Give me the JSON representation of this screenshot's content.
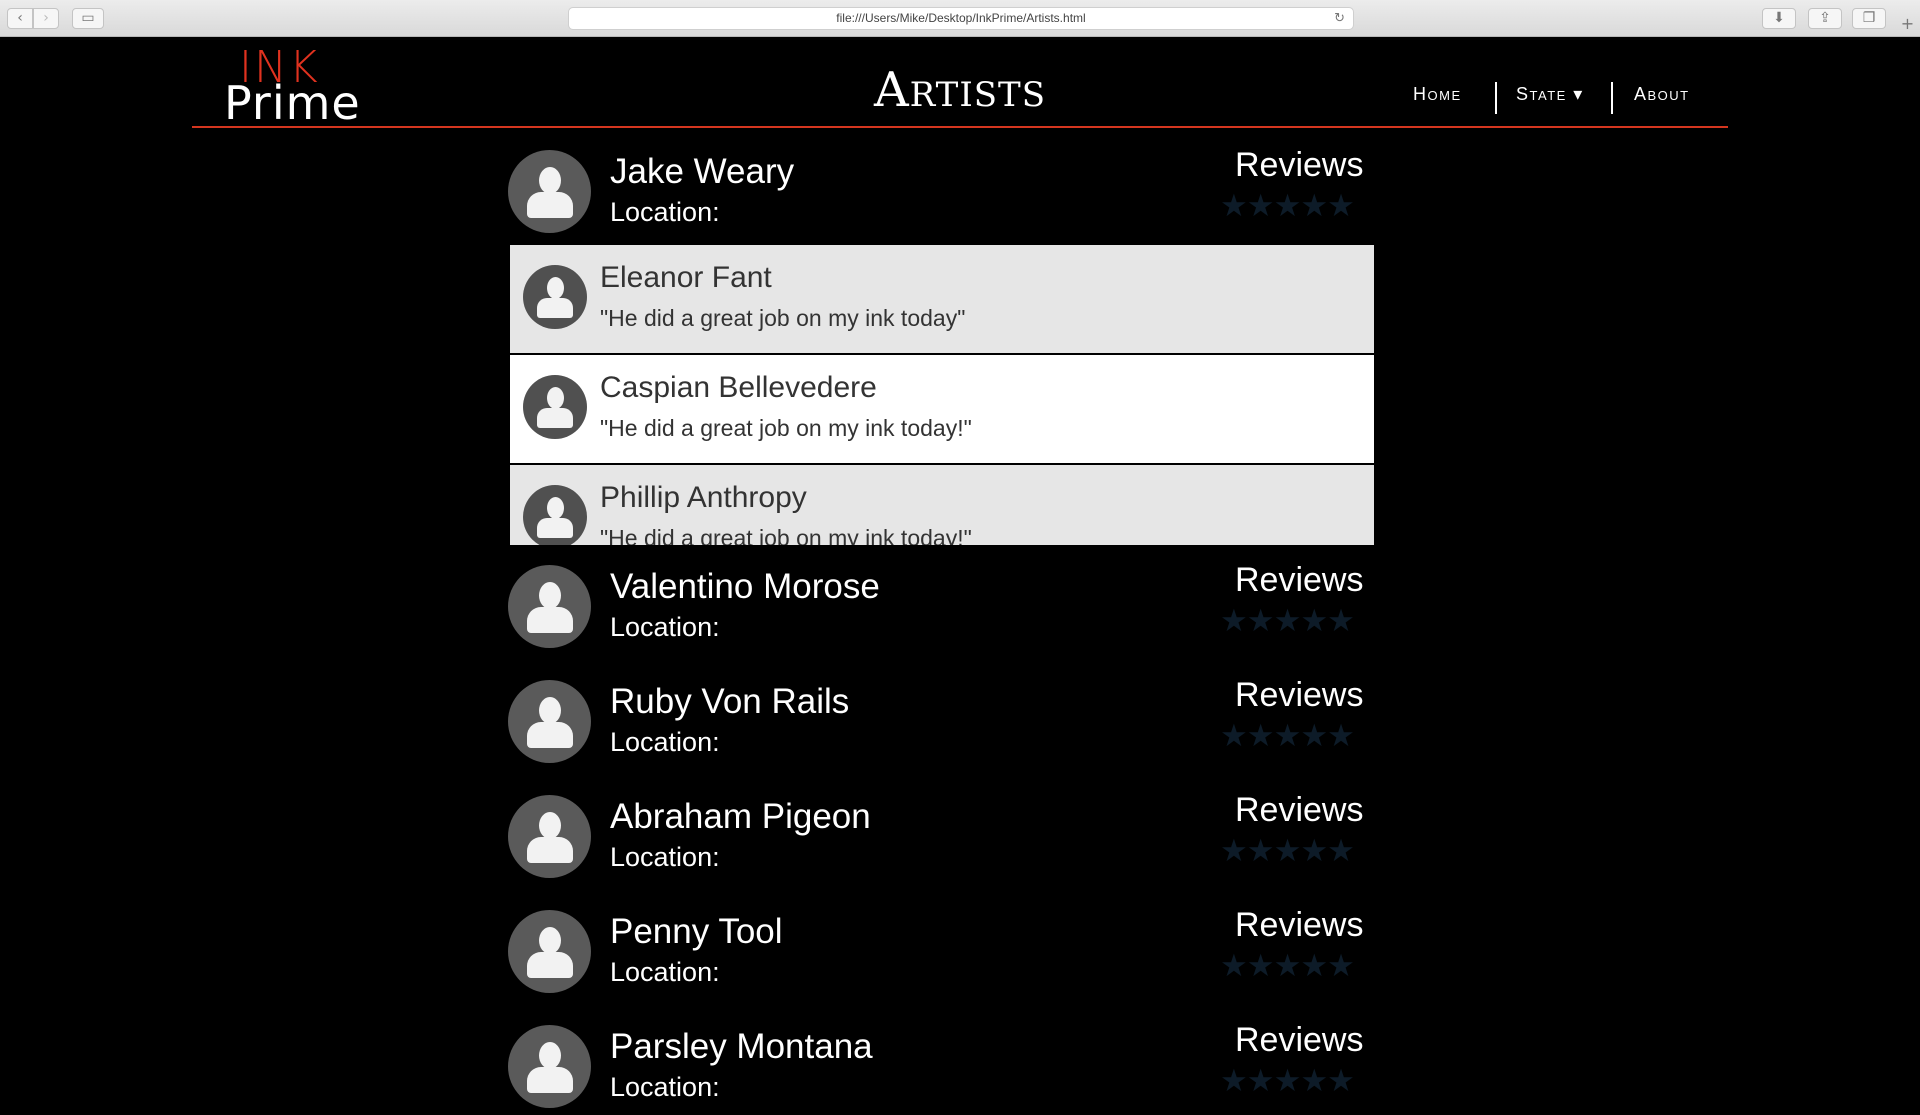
{
  "browser": {
    "address": "file:///Users/Mike/Desktop/InkPrime/Artists.html",
    "back_icon": "chevron-left-icon",
    "forward_icon": "chevron-right-icon",
    "sidebar_icon": "sidebar-icon",
    "reload_icon": "reload-icon",
    "download_icon": "download-icon",
    "share_icon": "share-icon",
    "tabs_icon": "tabs-icon",
    "newtab_icon": "plus-icon"
  },
  "header": {
    "logo_top": "INK",
    "logo_bottom": "Prime",
    "title": "Artists",
    "nav": {
      "home": "Home",
      "state": "State ▾",
      "about": "About"
    },
    "accent_color": "#d4361f"
  },
  "artists": [
    {
      "name": "Jake Weary",
      "location_label": "Location:",
      "reviews_label": "Reviews",
      "rating_stars": 0
    },
    {
      "name": "Valentino Morose",
      "location_label": "Location:",
      "reviews_label": "Reviews",
      "rating_stars": 0
    },
    {
      "name": "Ruby Von Rails",
      "location_label": "Location:",
      "reviews_label": "Reviews",
      "rating_stars": 0
    },
    {
      "name": "Abraham Pigeon",
      "location_label": "Location:",
      "reviews_label": "Reviews",
      "rating_stars": 0
    },
    {
      "name": "Penny Tool",
      "location_label": "Location:",
      "reviews_label": "Reviews",
      "rating_stars": 0
    },
    {
      "name": "Parsley Montana",
      "location_label": "Location:",
      "reviews_label": "Reviews",
      "rating_stars": 0
    }
  ],
  "reviews": [
    {
      "name": "Eleanor Fant",
      "text": "\"He did a great job on my ink today\""
    },
    {
      "name": "Caspian Bellevedere",
      "text": "\"He did a great job on my ink today!\""
    },
    {
      "name": "Phillip Anthropy",
      "text": "\"He did a great job on my ink today!\""
    }
  ],
  "stars_glyph": "★★★★★"
}
